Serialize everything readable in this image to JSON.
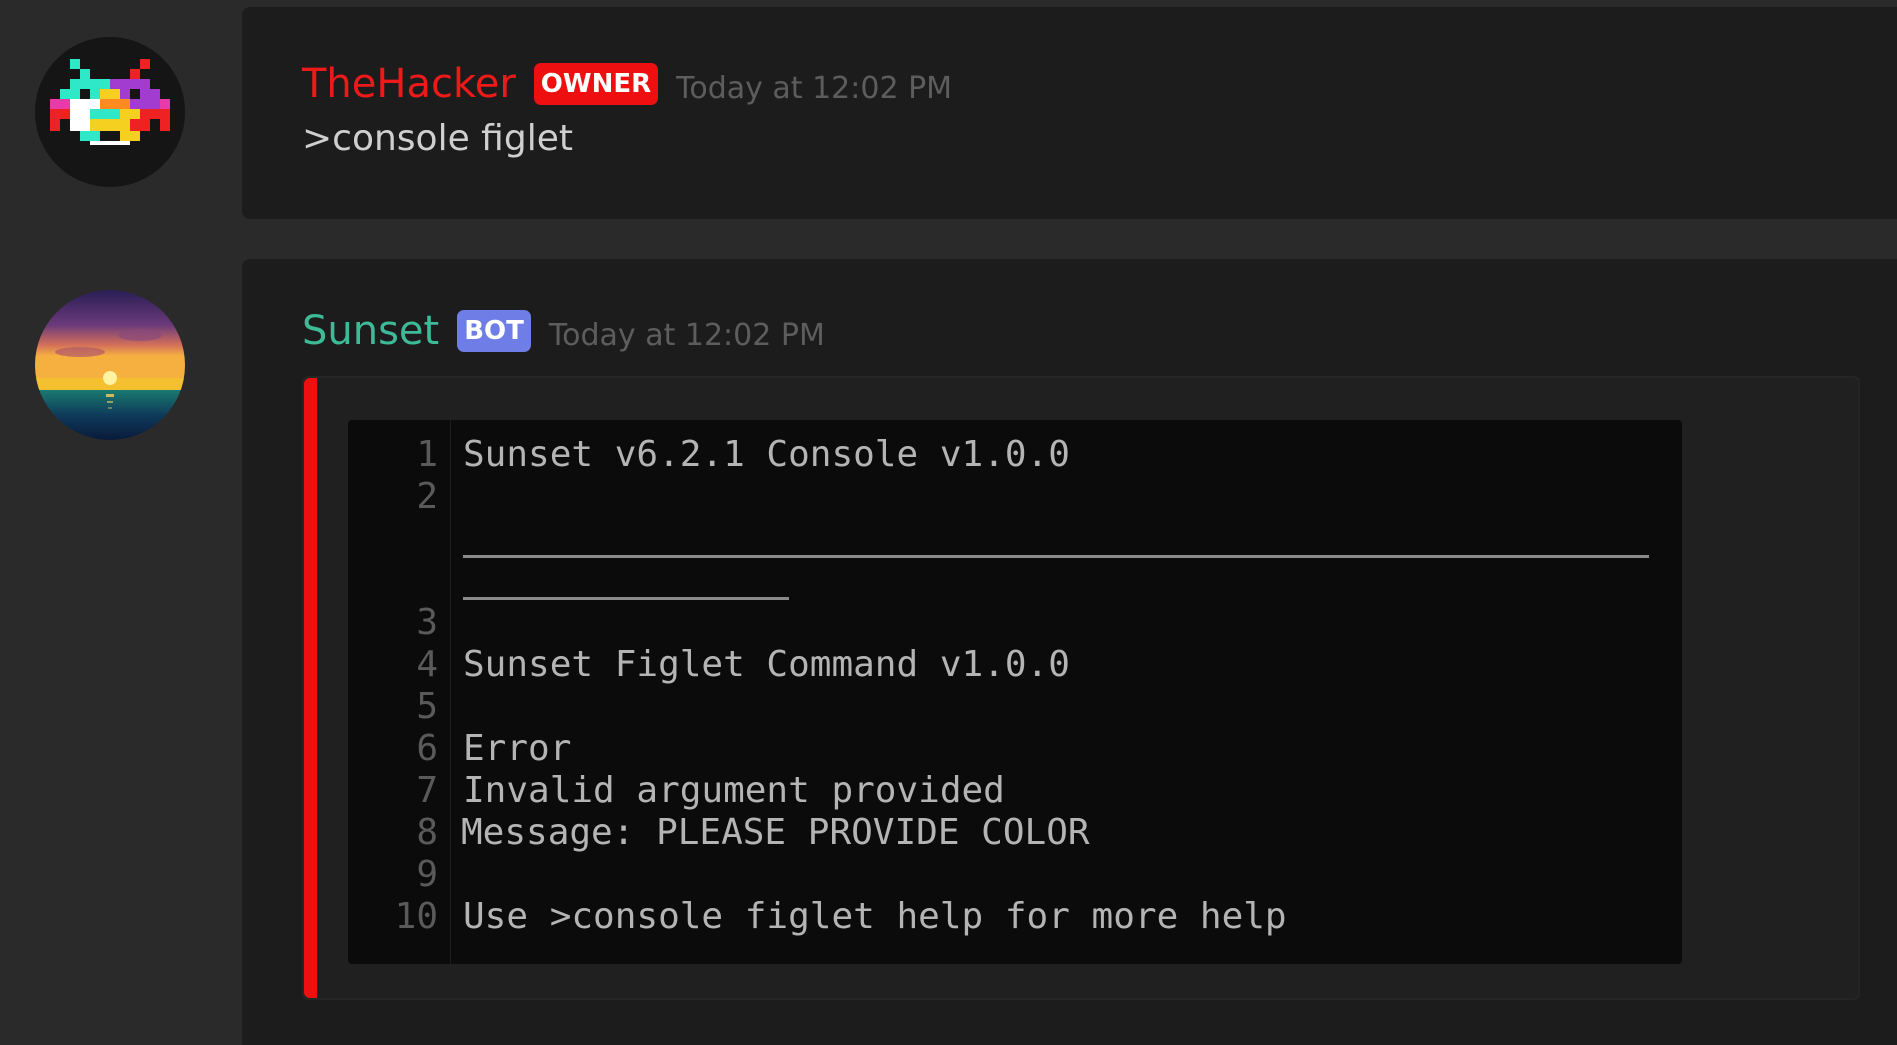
{
  "messages": [
    {
      "username": "TheHacker",
      "username_color": "#ee1a1a",
      "badge": "OWNER",
      "badge_color": "#ee1010",
      "timestamp": "Today at 12:02 PM",
      "content": ">console figlet",
      "avatar": "space-invader-avatar"
    },
    {
      "username": "Sunset",
      "username_color": "#3dba96",
      "badge": "BOT",
      "badge_color": "#6f7ee6",
      "timestamp": "Today at 12:02 PM",
      "avatar": "sunset-avatar",
      "embed": {
        "accent_color": "#ee1010",
        "line_numbers": [
          "1",
          "2",
          "3",
          "4",
          "5",
          "6",
          "7",
          "8",
          "9",
          "10"
        ],
        "lines": {
          "l1": "Sunset v6.2.1 Console v1.0.0",
          "l4": "Sunset Figlet Command v1.0.0",
          "l6": "Error",
          "l7": "Invalid argument provided",
          "l8": "Message: PLEASE PROVIDE COLOR",
          "l10": "Use >console figlet help for more help"
        }
      }
    }
  ]
}
